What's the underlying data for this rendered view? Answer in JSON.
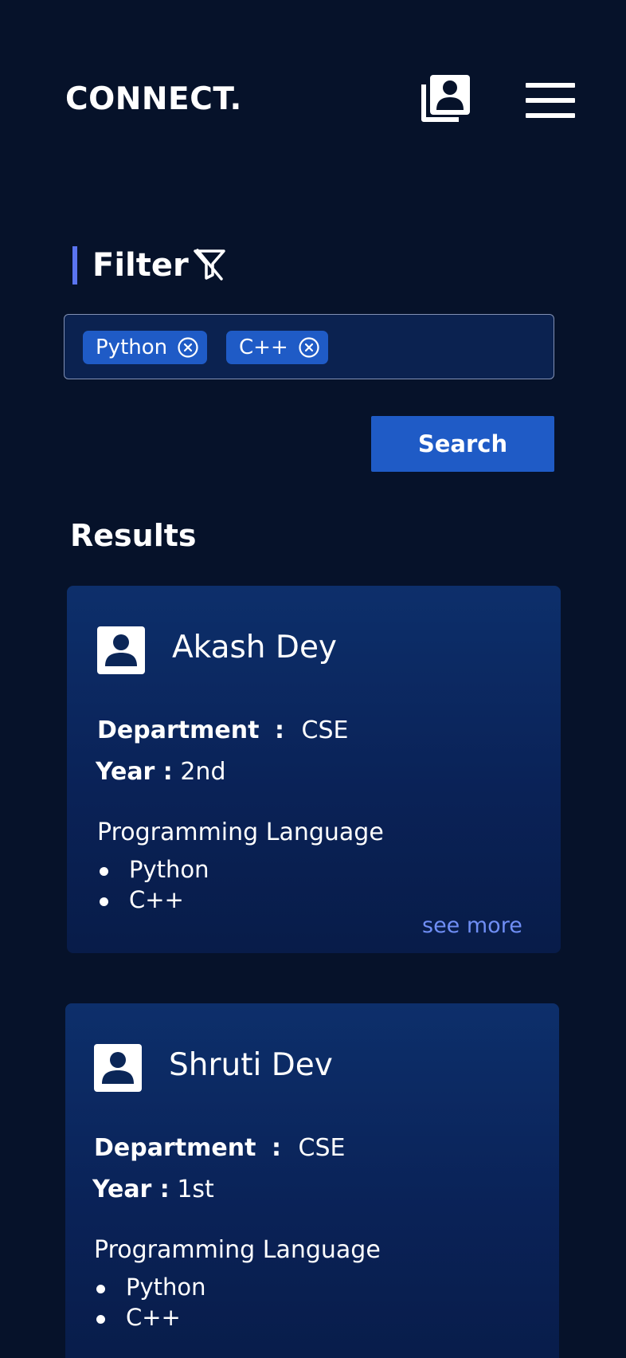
{
  "header": {
    "logo": "CONNECT.",
    "contacts_icon": "contact-book-icon",
    "menu_icon": "hamburger-menu-icon"
  },
  "filter": {
    "title": "Filter",
    "icon": "filter-icon",
    "chips": [
      {
        "label": "Python",
        "remove_icon": "close-circle-icon"
      },
      {
        "label": "C++",
        "remove_icon": "close-circle-icon"
      }
    ],
    "search_label": "Search"
  },
  "results": {
    "title": "Results",
    "cards": [
      {
        "name": "Akash Dey",
        "department_label": "Department",
        "department_sep": ":",
        "department": "CSE",
        "year_label": "Year :",
        "year": "2nd",
        "languages_heading": "Programming Language",
        "languages": [
          "Python",
          "C++"
        ],
        "see_more": "see more"
      },
      {
        "name": "Shruti Dev",
        "department_label": "Department",
        "department_sep": ":",
        "department": "CSE",
        "year_label": "Year :",
        "year": "1st",
        "languages_heading": "Programming Language",
        "languages": [
          "Python",
          "C++"
        ]
      }
    ]
  },
  "colors": {
    "background": "#06122a",
    "accent": "#1f5bc6",
    "card": "#0a2257",
    "link": "#6f8ef5",
    "filter_bar": "#5a74f0"
  }
}
